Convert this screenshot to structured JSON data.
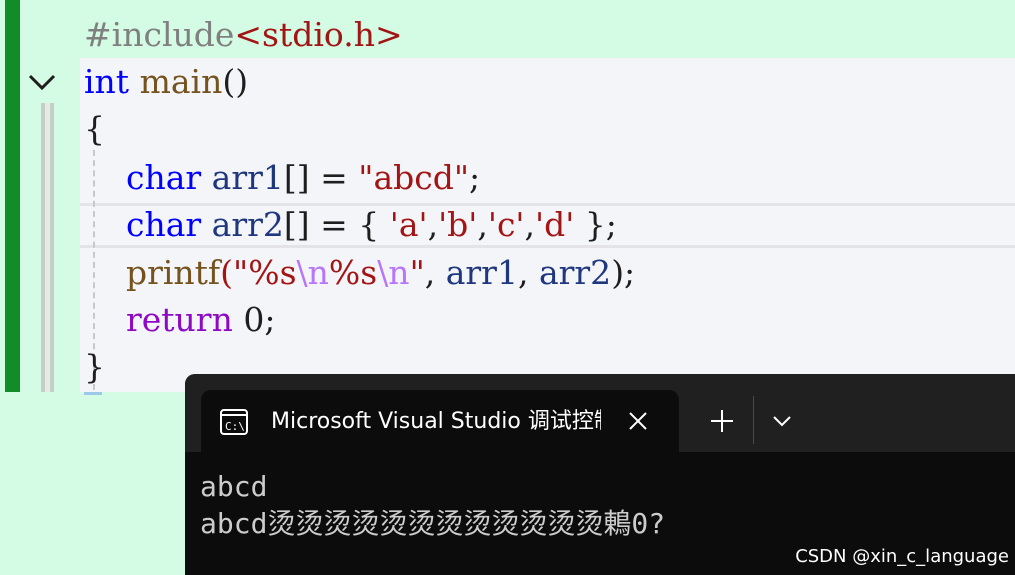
{
  "editor": {
    "lines": [
      [
        {
          "t": "#include",
          "c": "kw-pp"
        },
        {
          "t": "<stdio.h>",
          "c": "str"
        }
      ],
      [
        {
          "t": "int",
          "c": "type"
        },
        {
          "t": " "
        },
        {
          "t": "main",
          "c": "fn"
        },
        {
          "t": "()"
        }
      ],
      [
        {
          "t": "{"
        }
      ],
      [
        {
          "t": "    "
        },
        {
          "t": "char",
          "c": "type"
        },
        {
          "t": " "
        },
        {
          "t": "arr1",
          "c": "var"
        },
        {
          "t": "[] = "
        },
        {
          "t": "\"abcd\"",
          "c": "str"
        },
        {
          "t": ";"
        }
      ],
      [
        {
          "t": "    "
        },
        {
          "t": "char",
          "c": "type"
        },
        {
          "t": " "
        },
        {
          "t": "arr2",
          "c": "var"
        },
        {
          "t": "[] = { "
        },
        {
          "t": "'a'",
          "c": "str"
        },
        {
          "t": ","
        },
        {
          "t": "'b'",
          "c": "str"
        },
        {
          "t": ","
        },
        {
          "t": "'c'",
          "c": "str"
        },
        {
          "t": ","
        },
        {
          "t": "'d'",
          "c": "str"
        },
        {
          "t": " };"
        }
      ],
      [
        {
          "t": "    "
        },
        {
          "t": "printf",
          "c": "fn"
        },
        {
          "t": "(\"%s",
          "c": "str"
        },
        {
          "t": "\\n",
          "c": "esc"
        },
        {
          "t": "%s",
          "c": "str"
        },
        {
          "t": "\\n",
          "c": "esc"
        },
        {
          "t": "\"",
          "c": "str"
        },
        {
          "t": ", "
        },
        {
          "t": "arr1",
          "c": "var"
        },
        {
          "t": ", "
        },
        {
          "t": "arr2",
          "c": "var"
        },
        {
          "t": ");"
        }
      ],
      [
        {
          "t": "    "
        },
        {
          "t": "return",
          "c": "ctrl"
        },
        {
          "t": " 0;"
        }
      ],
      [
        {
          "t": "}"
        }
      ]
    ]
  },
  "terminal": {
    "tab_title": "Microsoft Visual Studio 调试控制台",
    "tab_icon": "console-icon",
    "output": [
      "abcd",
      "abcd烫烫烫烫烫烫烫烫烫烫烫烫鶇0?"
    ]
  },
  "watermark": "CSDN @xin_c_language",
  "colors": {
    "editor_background": "#d4fbe4",
    "change_bar": "#128c28",
    "terminal_background": "#0c0c0c",
    "keyword": "#0000ff",
    "string": "#a31515"
  }
}
